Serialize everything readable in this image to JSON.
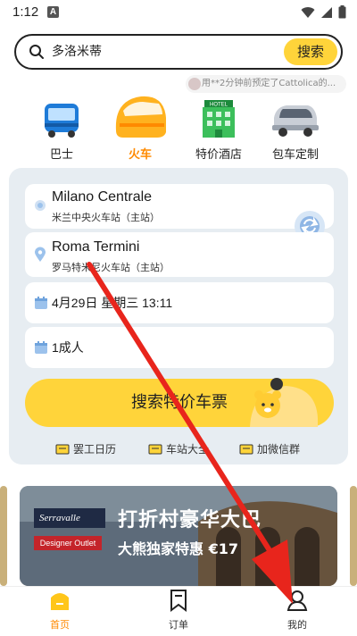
{
  "status": {
    "time": "1:12",
    "notif": "A"
  },
  "search": {
    "value": "多洛米蒂",
    "button": "搜索"
  },
  "notice": {
    "text": "用**2分钟前预定了Cattolica的..."
  },
  "categories": [
    {
      "label": "巴士",
      "icon": "bus-icon"
    },
    {
      "label": "火车",
      "icon": "train-icon",
      "active": true
    },
    {
      "label": "特价酒店",
      "icon": "hotel-icon"
    },
    {
      "label": "包车定制",
      "icon": "car-icon"
    }
  ],
  "booking": {
    "from_station": "Milano Centrale",
    "from_station_cn": "米兰中央火车站（主站）",
    "to_station": "Roma Termini",
    "to_station_cn": "罗马特米尼火车站（主站）",
    "date": "4月29日 星期三  13:11",
    "passengers": "1成人",
    "search_button": "搜索特价车票"
  },
  "links": [
    {
      "label": "罢工日历"
    },
    {
      "label": "车站大全"
    },
    {
      "label": "加微信群"
    }
  ],
  "banner": {
    "tag": "Serravalle",
    "tag2": "Designer Outlet",
    "title": "打折村豪华大巴",
    "subtitle": "大熊独家特惠 €17"
  },
  "tabs": [
    {
      "label": "首页",
      "active": true
    },
    {
      "label": "订单"
    },
    {
      "label": "我的"
    }
  ],
  "colors": {
    "accent": "#ffd43a",
    "active": "#ff8a00",
    "panel": "#e7edf2",
    "annotation": "#e8251c"
  }
}
